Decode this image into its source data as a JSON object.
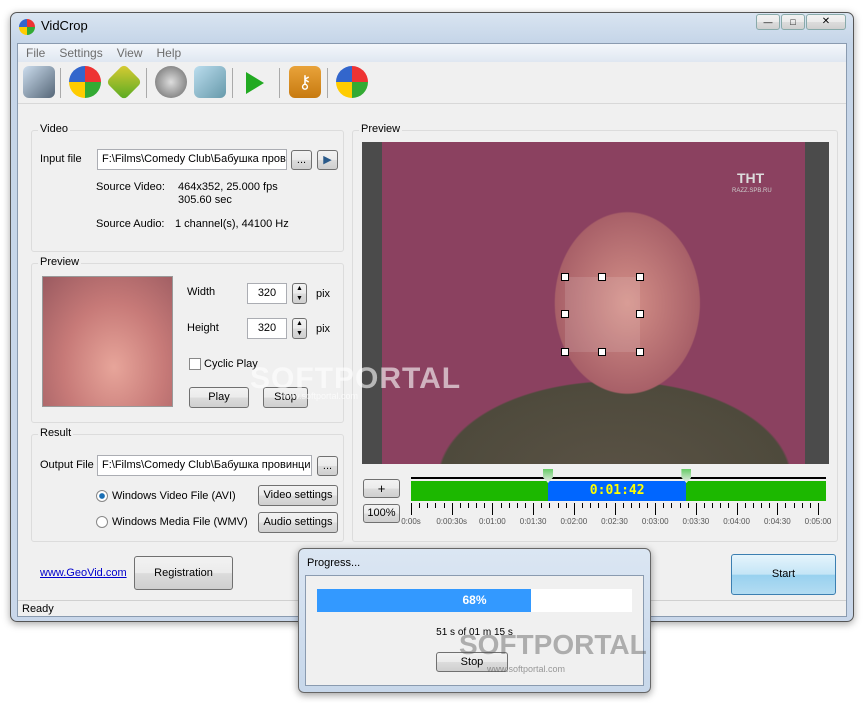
{
  "window": {
    "title": "VidCrop"
  },
  "menu": [
    "File",
    "Settings",
    "View",
    "Help"
  ],
  "toolbar": [
    "open-video-icon",
    "media-player-icon",
    "film-icon",
    "audio-icon",
    "display-settings-icon",
    "play-icon",
    "key-icon",
    "crop-icon"
  ],
  "video": {
    "title": "Video",
    "input_label": "Input file",
    "input_value": "F:\\Films\\Comedy Club\\Бабушка провинциальная",
    "browse": "...",
    "play": "▶",
    "src_video_label": "Source Video:",
    "src_video_1": "464x352, 25.000 fps",
    "src_video_2": "305.60 sec",
    "src_audio_label": "Source Audio:",
    "src_audio": "1 channel(s), 44100 Hz"
  },
  "preview_group": {
    "title": "Preview",
    "width_label": "Width",
    "width": "320",
    "height_label": "Height",
    "height": "320",
    "unit": "pix",
    "cyclic": "Cyclic Play",
    "cyclic_checked": false,
    "play": "Play",
    "stop": "Stop"
  },
  "result": {
    "title": "Result",
    "output_label": "Output File",
    "output_value": "F:\\Films\\Comedy Club\\Бабушка провинциальная",
    "browse": "...",
    "avi": "Windows Video File (AVI)",
    "wmv": "Windows Media File (WMV)",
    "selected": "avi",
    "video_settings": "Video settings",
    "audio_settings": "Audio settings"
  },
  "link": "www.GeoVid.com",
  "registration": "Registration",
  "start": "Start",
  "status": "Ready",
  "preview": {
    "title": "Preview",
    "channel_logo": "ТНТ",
    "channel_sub": "RAZZ.SPB.RU",
    "zoom_in": "+",
    "zoom": "100%"
  },
  "timeline": {
    "duration_s": 305.6,
    "sel_start_s": 101,
    "sel_end_s": 203,
    "sel_label": "0:01:42",
    "ticks": [
      "0:00s",
      "0:00:30s",
      "0:01:00",
      "0:01:30",
      "0:02:00",
      "0:02:30",
      "0:03:00",
      "0:03:30",
      "0:04:00",
      "0:04:30",
      "0:05:00"
    ]
  },
  "progress": {
    "title": "Progress...",
    "percent": 68,
    "percent_label": "68%",
    "detail": "51 s of 01 m 15 s",
    "stop": "Stop"
  },
  "watermark": {
    "text": "SOFTPORTAL",
    "url": "www.softportal.com"
  },
  "colors": {
    "accent": "#3399ff",
    "timeline_green": "#1cb800",
    "selection_blue": "#0066ff",
    "sel_text": "#ffff00"
  }
}
